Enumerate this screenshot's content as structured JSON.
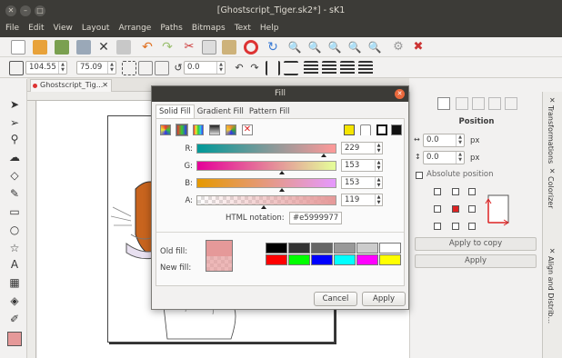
{
  "window": {
    "title": "[Ghostscript_Tiger.sk2*] - sK1"
  },
  "menu": [
    "File",
    "Edit",
    "View",
    "Layout",
    "Arrange",
    "Paths",
    "Bitmaps",
    "Text",
    "Help"
  ],
  "toolbar2": {
    "x_value": "104.55",
    "y_value": "75.09",
    "angle_value": "0.0"
  },
  "doc_tab": {
    "label": "Ghostscript_Tig..."
  },
  "dialog": {
    "title": "Fill",
    "tabs": [
      "Solid Fill",
      "Gradient Fill",
      "Pattern Fill"
    ],
    "channels": [
      {
        "label": "R:",
        "value": "229"
      },
      {
        "label": "G:",
        "value": "153"
      },
      {
        "label": "B:",
        "value": "153"
      },
      {
        "label": "A:",
        "value": "119"
      }
    ],
    "html_label": "HTML notation:",
    "html_value": "#e5999977",
    "old_fill_label": "Old fill:",
    "new_fill_label": "New fill:",
    "old_fill_color": "#e59999",
    "new_fill_color": "#e59999",
    "palette": [
      "#000000",
      "#333333",
      "#666666",
      "#999999",
      "#cccccc",
      "#ffffff",
      "#ff0000",
      "#00ff00",
      "#0000ff",
      "#00ffff",
      "#ff00ff",
      "#ffff00"
    ],
    "cancel_label": "Cancel",
    "apply_label": "Apply"
  },
  "right_panel": {
    "heading": "Position",
    "x_value": "0.0",
    "y_value": "0.0",
    "unit": "px",
    "absolute_label": "Absolute position",
    "apply_copy_label": "Apply to copy",
    "apply_label": "Apply",
    "vtabs": [
      "Transformations",
      "Colorizer",
      "Align and Distrib..."
    ]
  }
}
